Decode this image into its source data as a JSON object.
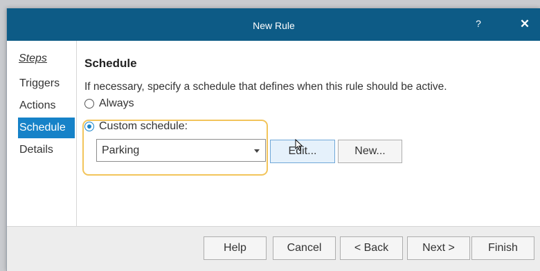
{
  "window": {
    "title": "New Rule",
    "help_glyph": "?",
    "close_glyph": "✕"
  },
  "steps": {
    "heading": "Steps",
    "items": [
      {
        "label": "Triggers",
        "active": false
      },
      {
        "label": "Actions",
        "active": false
      },
      {
        "label": "Schedule",
        "active": true
      },
      {
        "label": "Details",
        "active": false
      }
    ]
  },
  "schedule": {
    "title": "Schedule",
    "description": "If necessary, specify a schedule that defines when this rule should be active.",
    "options": [
      {
        "label": "Always",
        "checked": false
      },
      {
        "label": "Custom schedule:",
        "checked": true
      }
    ],
    "selected_schedule": "Parking",
    "edit_label": "Edit...",
    "new_label": "New..."
  },
  "footer": {
    "help_label": "Help",
    "cancel_label": "Cancel",
    "back_label": "< Back",
    "next_label": "Next >",
    "finish_label": "Finish"
  },
  "colors": {
    "titlebar": "#0d5b86",
    "accent": "#1682c8",
    "highlight": "#f2c45a"
  },
  "icons": {
    "dropdown": "chevron-down-icon",
    "cursor": "mouse-pointer-icon"
  }
}
